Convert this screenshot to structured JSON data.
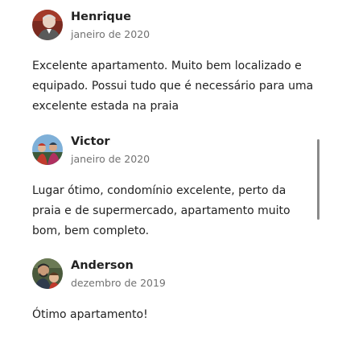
{
  "reviews": [
    {
      "name": "Henrique",
      "date": "janeiro de 2020",
      "text": "Excelente apartamento. Muito bem localizado e equipado. Possui tudo que é necessário para uma excelente estada na praia",
      "avatar": "person-photo-icon"
    },
    {
      "name": "Victor",
      "date": "janeiro de 2020",
      "text": "Lugar ótimo, condomínio excelente, perto da praia e de supermercado, apartamento muito bom, bem completo.",
      "avatar": "person-photo-icon"
    },
    {
      "name": "Anderson",
      "date": "dezembro de 2019",
      "text": "Ótimo apartamento!",
      "avatar": "person-photo-icon"
    }
  ],
  "colors": {
    "text": "#222222",
    "secondary_text": "#717171",
    "background": "#ffffff",
    "scrollbar": "#8a8a8a"
  },
  "scroll": {
    "position_fraction": 0.43
  }
}
